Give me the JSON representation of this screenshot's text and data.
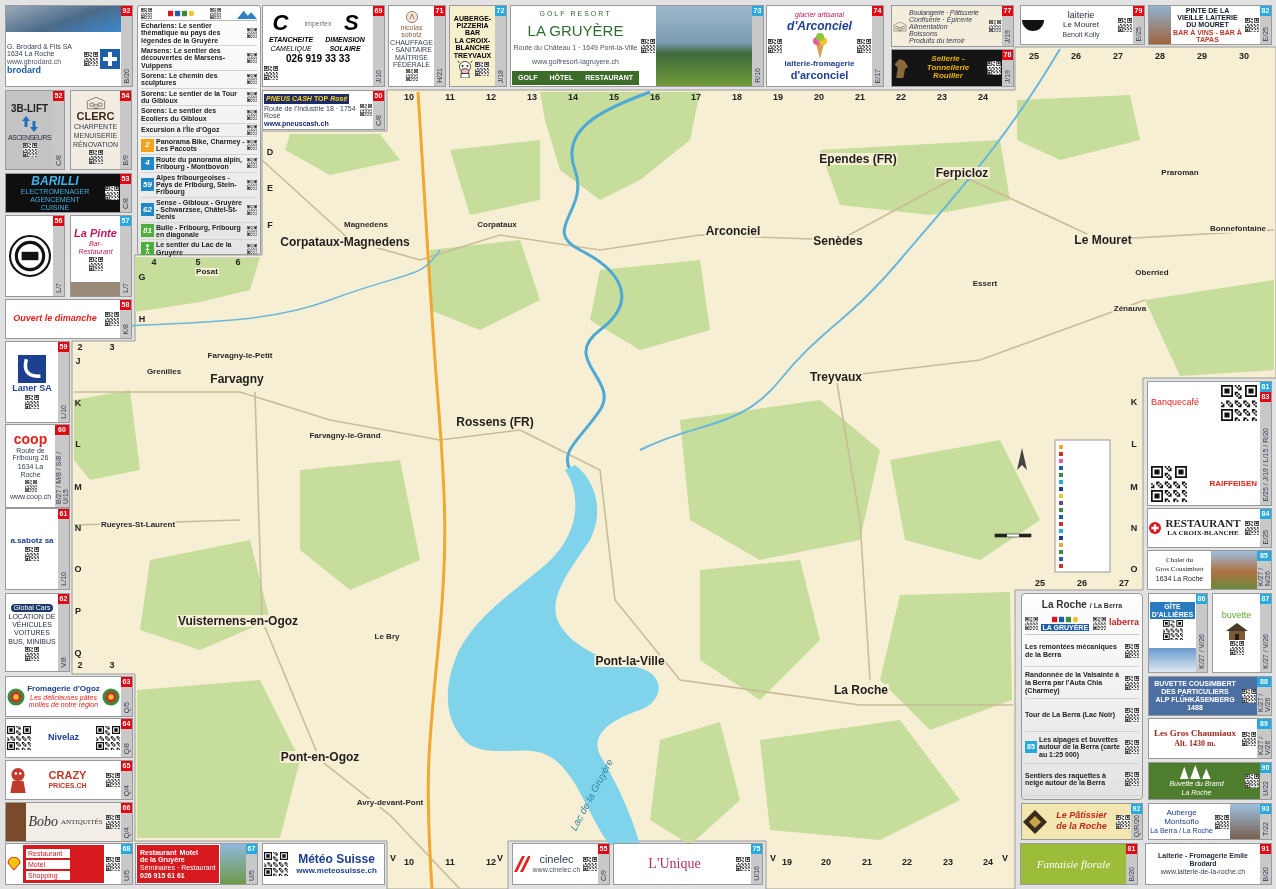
{
  "trail_panel": {
    "trails": [
      "Echarlens: Le sentier thématique au pays des légendes de la Gruyère",
      "Marsens: Le sentier des découvertes de Marsens-Vuippens",
      "Sorens: Le chemin des sculptures",
      "Sorens: Le sentier de la Tour du Gibloux",
      "Sorens: Le sentier des Ecoliers du Gibloux",
      "Excursion à l'Île d'Ogoz"
    ],
    "routes": [
      {
        "number": "2",
        "color": "#f4a31b",
        "text": "Panorama Bike, Charmey - Les Paccots"
      },
      {
        "number": "4",
        "color": "#1e88c9",
        "text": "Route du panorama alpin, Fribourg - Montbovon"
      },
      {
        "number": "59",
        "color": "#1e88c9",
        "text": "Alpes fribourgeoises - Pays de Fribourg, Stein-Fribourg"
      },
      {
        "number": "62",
        "color": "#1e88c9",
        "text": "Sense - Gibloux - Gruyère - Schwarzsee, Châtel-St-Denis"
      },
      {
        "number": "81",
        "color": "#4caf3a",
        "text": "Bulle - Fribourg, Fribourg en diagonale"
      },
      {
        "color": "#4caf3a",
        "text": "Le sentier du Lac de la Gruyère"
      }
    ]
  },
  "ads": [
    {
      "badges": [
        {
          "text": "92",
          "color": "#e30613"
        }
      ],
      "ref": "B/20",
      "texts": [
        "G. Brodard & Fils SA",
        "1634 La Roche",
        "www.gbrodard.ch",
        "brodard"
      ]
    },
    {
      "badges": [
        {
          "text": "69",
          "color": "#e30613"
        }
      ],
      "ref": "J/10",
      "texts": [
        "C",
        "imperfex",
        "S",
        "ETANCHEITE",
        "DIMENSION",
        "CAMELIQUE",
        "SOLAIRE",
        "026 919 33 33"
      ]
    },
    {
      "badges": [
        {
          "text": "50",
          "color": "#e30613"
        }
      ],
      "ref": "C/8",
      "texts": [
        "PNEUS CASH",
        "TOP",
        "Rosé",
        "Route de l'Industrie 18 · 1754 Rosé",
        "www.pneuscash.ch"
      ]
    },
    {
      "badges": [
        {
          "text": "71",
          "color": "#e30613"
        }
      ],
      "ref": "H/21",
      "texts": [
        "nicolas sobotz",
        "CHAUFFAGE · SANITAIRE",
        "MAÎTRISE FÉDÉRALE"
      ]
    },
    {
      "badges": [
        {
          "text": "72",
          "color": "#27aae1"
        }
      ],
      "ref": "J/18",
      "texts": [
        "AUBERGE-PIZZERIA BAR",
        "LA CROIX-BLANCHE",
        "TREYVAUX"
      ]
    },
    {
      "badges": [
        {
          "text": "73",
          "color": "#27aae1"
        }
      ],
      "ref": "R/16",
      "texts": [
        "GOLF RESORT",
        "LA GRUYÈRE",
        "Route du Château 1 · 1649 Pont-la-Ville",
        "www.golfresort-lagruyere.ch",
        "GOLF",
        "HÔTEL",
        "RESTAURANT"
      ]
    },
    {
      "badges": [
        {
          "text": "74",
          "color": "#e30613"
        }
      ],
      "ref": "E/17",
      "texts": [
        "glacier artisanal",
        "d'Arconciel",
        "laiterie-fromagerie",
        "d'arconciel"
      ]
    },
    {
      "badges": [
        {
          "text": "77",
          "color": "#e30613"
        }
      ],
      "ref": "J/19",
      "texts": [
        "Boulangerie · Pâtisserie",
        "Confiserie · Épicerie",
        "Alimentation",
        "Boissons",
        "Produits du terroir"
      ]
    },
    {
      "badges": [
        {
          "text": "78",
          "color": "#e30613"
        }
      ],
      "ref": "J/19",
      "texts": [
        "Sellerie - Tonnellerie Rouiller"
      ]
    },
    {
      "badges": [
        {
          "text": "79",
          "color": "#e30613"
        }
      ],
      "ref": "E/25",
      "texts": [
        "laiterie",
        "Le Mouret",
        "Benoit Kolly"
      ]
    },
    {
      "badges": [
        {
          "text": "82",
          "color": "#27aae1"
        }
      ],
      "ref": "E/25",
      "texts": [
        "PINTE DE LA VIEILLE LAITERIE DU MOURET",
        "BAR À VINS - BAR À TAPAS"
      ]
    },
    {
      "badges": [
        {
          "text": "52",
          "color": "#e30613"
        }
      ],
      "ref": "C/8",
      "texts": [
        "3B-LIFT",
        "ASCENSEURS"
      ]
    },
    {
      "badges": [
        {
          "text": "54",
          "color": "#e30613"
        }
      ],
      "ref": "B/9",
      "texts": [
        "CLERC",
        "CHARPENTE",
        "MENUISERIE",
        "RÉNOVATION"
      ]
    },
    {
      "badges": [
        {
          "text": "53",
          "color": "#e30613"
        }
      ],
      "ref": "C/8",
      "texts": [
        "BARILLI",
        "ELECTROMENAGER",
        "AGENCEMENT",
        "CUISINE"
      ]
    },
    {
      "badges": [
        {
          "text": "56",
          "color": "#e30613"
        }
      ],
      "ref": "L/7"
    },
    {
      "badges": [
        {
          "text": "57",
          "color": "#27aae1"
        }
      ],
      "ref": "L/7",
      "texts": [
        "La Pinte",
        "Bar-Restaurant"
      ]
    },
    {
      "badges": [
        {
          "text": "58",
          "color": "#e30613"
        }
      ],
      "ref": "K/8",
      "texts": [
        "Ouvert le dimanche"
      ]
    },
    {
      "badges": [
        {
          "text": "59",
          "color": "#e30613"
        }
      ],
      "ref": "L/10",
      "texts": [
        "Laner SA"
      ]
    },
    {
      "badges": [
        {
          "text": "60",
          "color": "#e30613"
        }
      ],
      "ref": "B/27 / M/8 / S/8 / U/15",
      "texts": [
        "coop",
        "Route de Fribourg 26",
        "1634 La Roche",
        "www.coop.ch"
      ]
    },
    {
      "badges": [
        {
          "text": "61",
          "color": "#e30613"
        }
      ],
      "ref": "L/10",
      "texts": [
        "a.sabotz sa"
      ]
    },
    {
      "badges": [
        {
          "text": "62",
          "color": "#e30613"
        }
      ],
      "ref": "V/8",
      "texts": [
        "Global Cars",
        "LOCATION DE VÉHICULES",
        "VOITURES",
        "BUS, MINIBUS"
      ]
    },
    {
      "badges": [
        {
          "text": "63",
          "color": "#e30613"
        }
      ],
      "ref": "Q/5",
      "texts": [
        "Fromagerie d'Ogoz",
        "Les délicieuses pâtes molles de notre région"
      ]
    },
    {
      "badges": [
        {
          "text": "64",
          "color": "#e30613"
        }
      ],
      "ref": "Q/8",
      "texts": [
        "Nivelaz"
      ]
    },
    {
      "badges": [
        {
          "text": "65",
          "color": "#e30613"
        }
      ],
      "ref": "Q/4",
      "texts": [
        "CRAZY",
        "PRICES.CH"
      ]
    },
    {
      "badges": [
        {
          "text": "66",
          "color": "#e30613"
        }
      ],
      "ref": "Q/4",
      "texts": [
        "Bobo",
        "ANTIQUITÉS"
      ]
    },
    {
      "badges": [
        {
          "text": "68",
          "color": "#27aae1"
        }
      ],
      "ref": "U/5",
      "texts": [
        "Restaurant",
        "Motel",
        "Shopping"
      ]
    },
    {
      "badges": [
        {
          "text": "67",
          "color": "#27aae1"
        }
      ],
      "ref": "U/5",
      "texts": [
        "Restaurant",
        "Motel",
        "de la Gruyère",
        "Séminaires · Restaurant",
        "026 915 61 61"
      ]
    },
    {
      "texts": [
        "Météo Suisse",
        "www.meteosuisse.ch"
      ]
    },
    {
      "badges": [
        {
          "text": "55",
          "color": "#e30613"
        }
      ],
      "ref": "C/9",
      "texts": [
        "cinelec",
        "www.cinelec.ch"
      ]
    },
    {
      "badges": [
        {
          "text": "75",
          "color": "#27aae1"
        }
      ],
      "ref": "U/16",
      "texts": [
        "L'Unique"
      ]
    },
    {
      "badges": [
        {
          "text": "81",
          "color": "#27aae1"
        },
        {
          "text": "83",
          "color": "#e30613"
        }
      ],
      "ref": "E/25 / J/19 / L/15 / R/20",
      "texts": [
        "Banquecafé",
        "RAIFFEISEN"
      ]
    },
    {
      "badges": [
        {
          "text": "84",
          "color": "#27aae1"
        }
      ],
      "ref": "E/25",
      "texts": [
        "RESTAURANT",
        "LA CROIX-BLANCHE"
      ]
    },
    {
      "badges": [
        {
          "text": "85",
          "color": "#27aae1"
        }
      ],
      "ref": "K/27 / N/26",
      "texts": [
        "Chalet du",
        "Gros Cousimbert",
        "1634 La Roche"
      ]
    },
    {
      "badges": [
        {
          "text": "86",
          "color": "#27aae1"
        }
      ],
      "ref": "K/27 / V/26",
      "texts": [
        "GÎTE D'ALLIÈRES"
      ]
    },
    {
      "badges": [
        {
          "text": "87",
          "color": "#27aae1"
        }
      ],
      "ref": "K/27 / V/26",
      "texts": [
        "buvette"
      ]
    },
    {
      "badges": [
        {
          "text": "88",
          "color": "#27aae1"
        }
      ],
      "ref": "K/27 / V/26",
      "texts": [
        "BUVETTE COUSIMBERT DES PARTICULIERS",
        "ALP FLÜHKÄSENBERG 1488"
      ]
    },
    {
      "badges": [
        {
          "text": "89",
          "color": "#27aae1"
        }
      ],
      "ref": "K/27 / V/26",
      "texts": [
        "Les Gros Chaumiaux",
        "Alt. 1430 m."
      ]
    },
    {
      "badges": [
        {
          "text": "90",
          "color": "#27aae1"
        }
      ],
      "ref": "U/22",
      "texts": [
        "Buvette du Brand",
        "La Roche"
      ]
    },
    {
      "badges": [
        {
          "text": "92",
          "color": "#27aae1"
        }
      ],
      "ref": "Q/R/20",
      "texts": [
        "Le Pâtissier",
        "de la Roche"
      ]
    },
    {
      "badges": [
        {
          "text": "93",
          "color": "#27aae1"
        }
      ],
      "ref": "T/22",
      "texts": [
        "Auberge",
        "Montsoflo",
        "La Berra / La Roche"
      ]
    },
    {
      "badges": [
        {
          "text": "81",
          "color": "#e30613"
        }
      ],
      "ref": "B/20",
      "texts": [
        "Fantaisie florale"
      ]
    },
    {
      "badges": [
        {
          "text": "91",
          "color": "#e30613"
        }
      ],
      "ref": "B/20",
      "texts": [
        "Laiterie - Fromagerie Emile Brodard",
        "www.laiterie-de-la-roche.ch"
      ]
    }
  ],
  "berra_panel": {
    "title": "La Roche",
    "subtitle": "/ La Berra",
    "logos": [
      "LA GRUYÈRE",
      "laberra"
    ],
    "items": [
      {
        "text": "Les remontées mécaniques de la Berra"
      },
      {
        "text": "Randonnée de la Valsainte à la Berra par l'Auta Chia (Charmey)"
      },
      {
        "text": "Tour de La Berra (Lac Noir)"
      },
      {
        "number": "85",
        "text": "Les alpages et buvettes autour de la Berra (carte au 1:25 000)"
      },
      {
        "text": "Sentiers des raquettes à neige autour de la Berra"
      }
    ]
  },
  "map": {
    "places": [
      {
        "name": "Posat",
        "kind": "village"
      },
      {
        "name": "Magnedens",
        "kind": "village"
      },
      {
        "name": "Corpataux-Magnedens",
        "kind": "town"
      },
      {
        "name": "Corpataux",
        "kind": "village"
      },
      {
        "name": "Arconciel",
        "kind": "town"
      },
      {
        "name": "Ependes (FR)",
        "kind": "town"
      },
      {
        "name": "Ferpicloz",
        "kind": "town"
      },
      {
        "name": "Praroman",
        "kind": "village"
      },
      {
        "name": "Senèdes",
        "kind": "town"
      },
      {
        "name": "Le Mouret",
        "kind": "town"
      },
      {
        "name": "Bonnefontaine",
        "kind": "village"
      },
      {
        "name": "Oberried",
        "kind": "village"
      },
      {
        "name": "Essert",
        "kind": "village"
      },
      {
        "name": "Zénauva",
        "kind": "village"
      },
      {
        "name": "Farvagny-le-Petit",
        "kind": "village"
      },
      {
        "name": "Grenilles",
        "kind": "village"
      },
      {
        "name": "Farvagny",
        "kind": "town"
      },
      {
        "name": "Treyvaux",
        "kind": "town"
      },
      {
        "name": "Rossens (FR)",
        "kind": "town"
      },
      {
        "name": "Farvagny-le-Grand",
        "kind": "village"
      },
      {
        "name": "Rueyres-St-Laurent",
        "kind": "village"
      },
      {
        "name": "Vuisternens-en-Ogoz",
        "kind": "town"
      },
      {
        "name": "Le Bry",
        "kind": "village"
      },
      {
        "name": "Pont-la-Ville",
        "kind": "town"
      },
      {
        "name": "La Roche",
        "kind": "town"
      },
      {
        "name": "Pont-en-Ogoz",
        "kind": "town"
      },
      {
        "name": "Avry-devant-Pont",
        "kind": "village"
      }
    ],
    "lake_label": "Lac de la Gruyère",
    "grid_labels": [
      "10",
      "11",
      "12",
      "13",
      "14",
      "15",
      "16",
      "17",
      "18",
      "19",
      "20",
      "21",
      "22",
      "23",
      "24",
      "25",
      "26",
      "27",
      "28",
      "29",
      "30",
      "D",
      "E",
      "F",
      "G",
      "H",
      "J",
      "K",
      "L",
      "M",
      "N",
      "O",
      "P",
      "Q",
      "4",
      "5",
      "6",
      "2",
      "3",
      "2",
      "3",
      "K",
      "L",
      "M",
      "N",
      "O",
      "25",
      "26",
      "27",
      "V",
      "10",
      "11",
      "12",
      "V",
      "V",
      "19",
      "20",
      "21",
      "22",
      "23",
      "24",
      "V"
    ]
  }
}
